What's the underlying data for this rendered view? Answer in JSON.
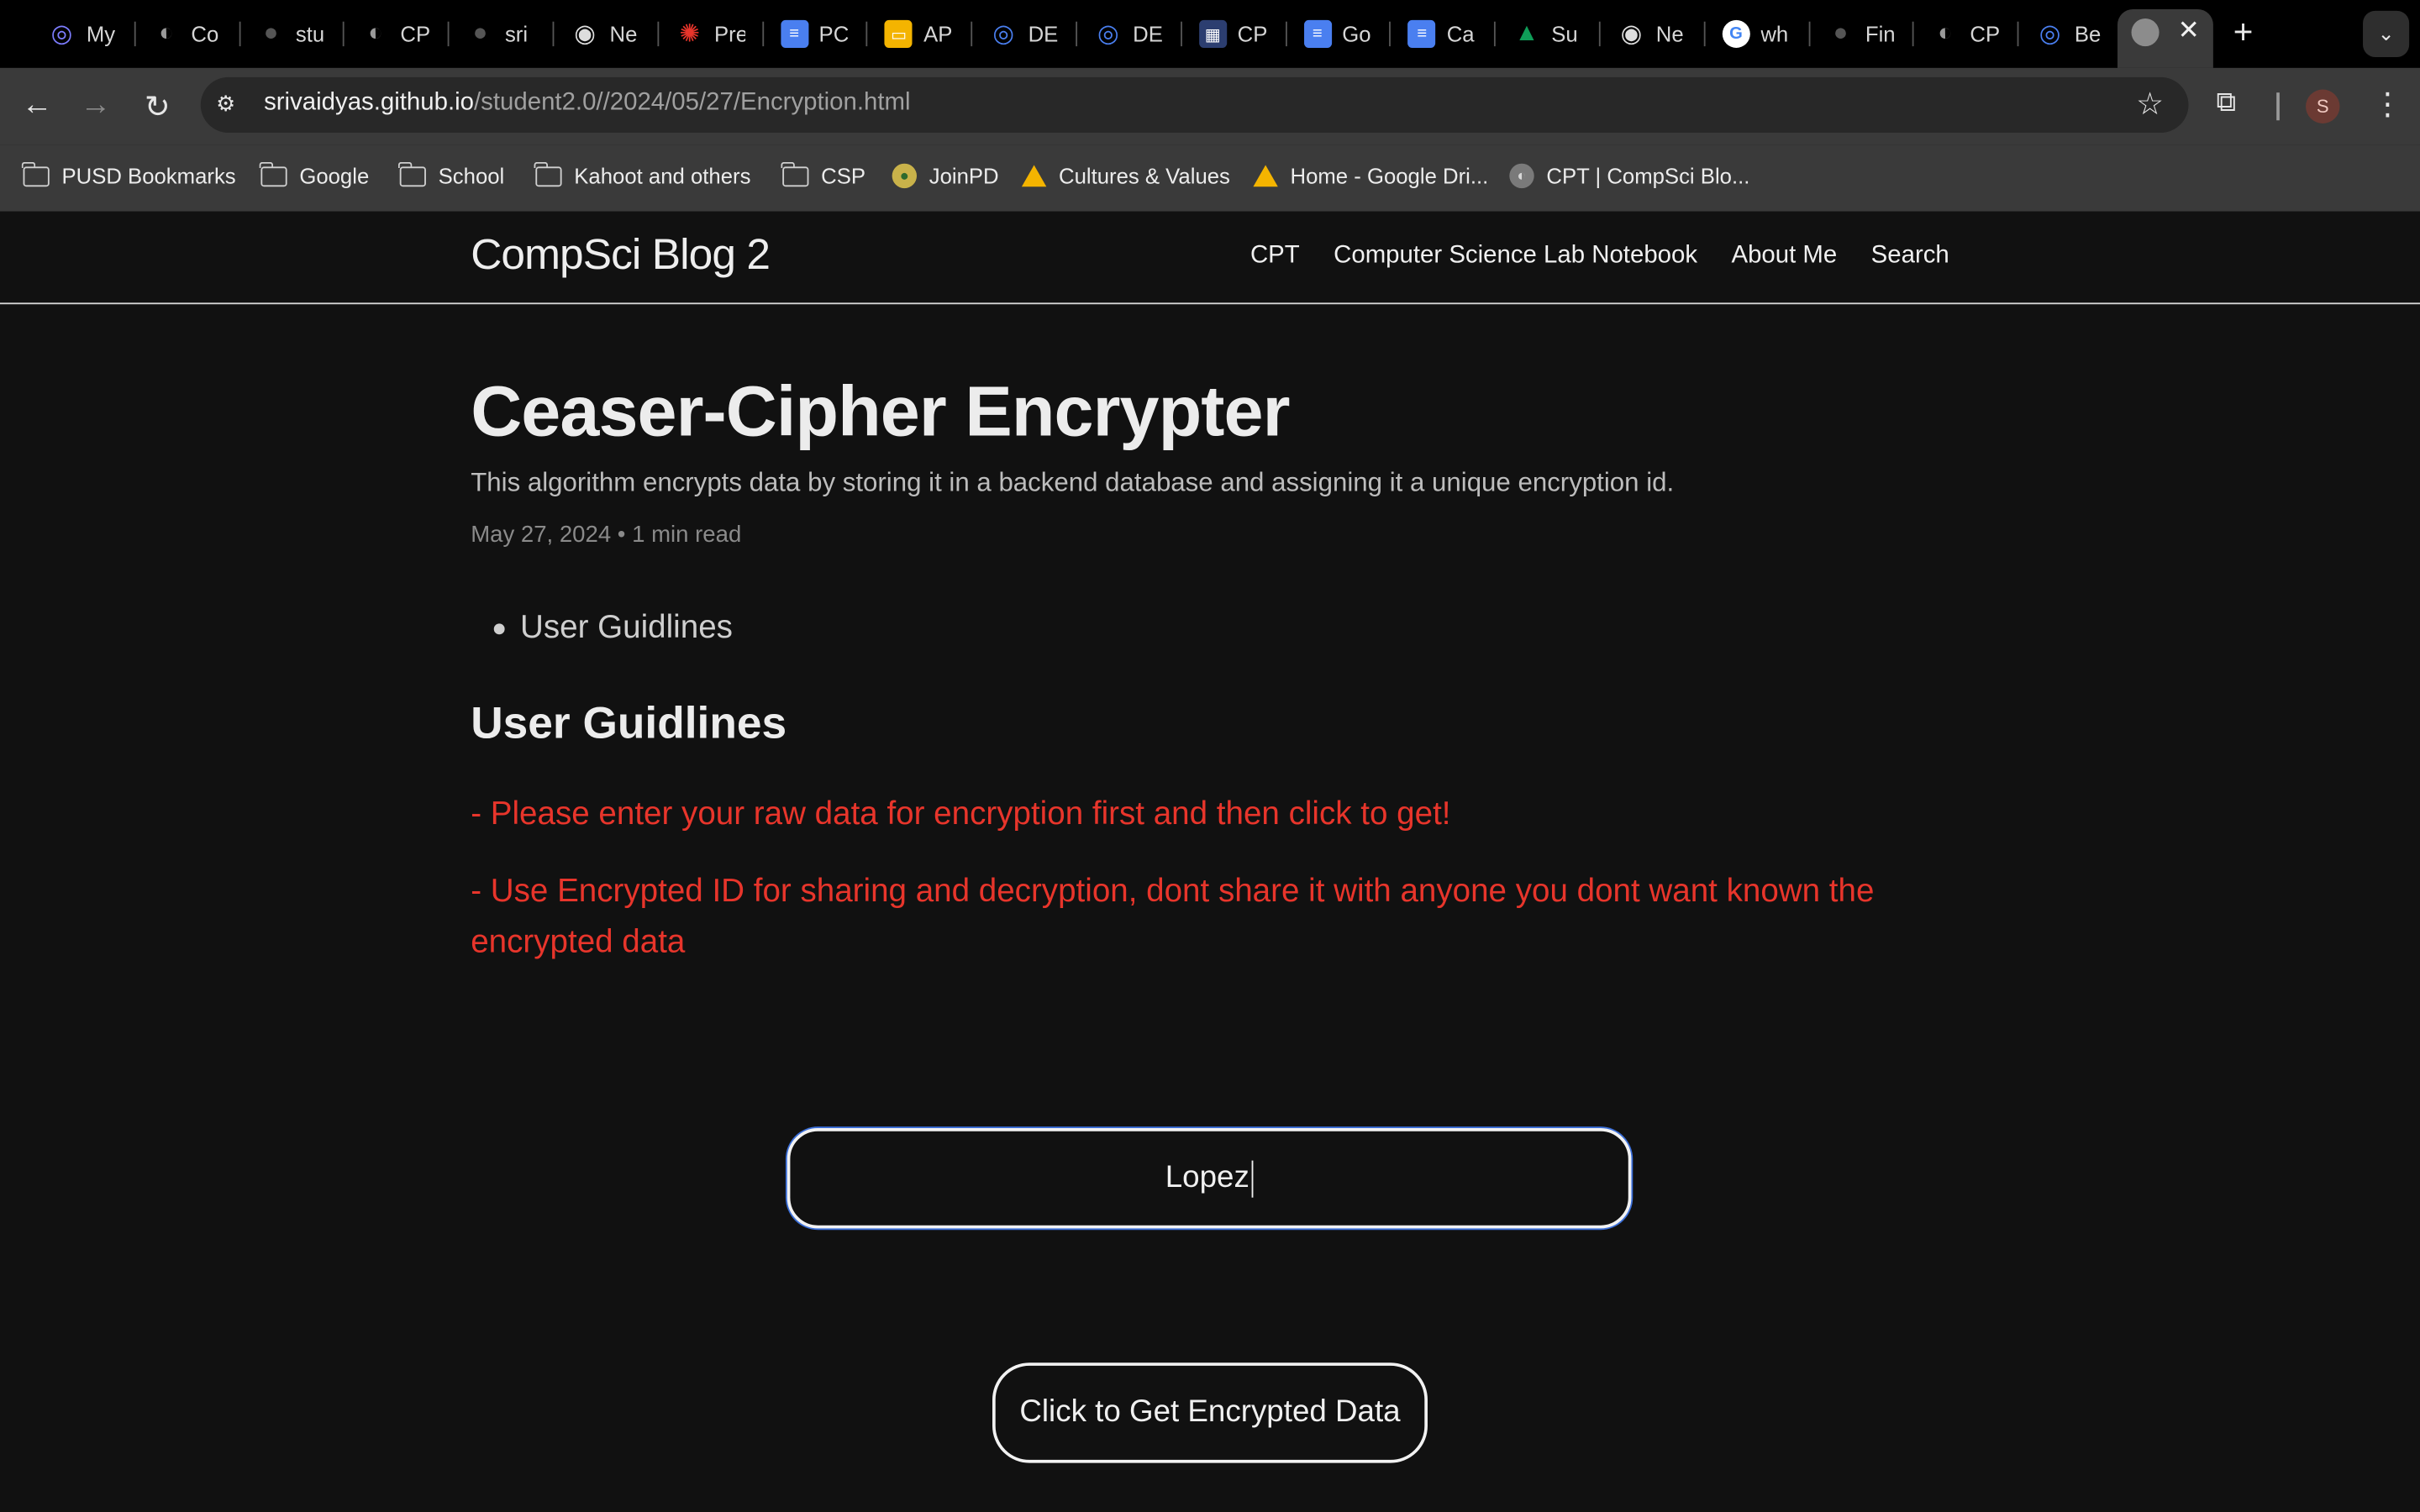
{
  "browser": {
    "tabs": [
      {
        "label": "My",
        "icon": "site-icon",
        "color": "#7d7dff"
      },
      {
        "label": "Co",
        "icon": "globe-icon",
        "color": "#9a9a9a"
      },
      {
        "label": "stu",
        "icon": "github-icon",
        "color": "#555555"
      },
      {
        "label": "CP",
        "icon": "globe-icon",
        "color": "#9a9a9a"
      },
      {
        "label": "sri",
        "icon": "github-icon",
        "color": "#555555"
      },
      {
        "label": "Ne",
        "icon": "chrome-icon",
        "color": "#dddddd"
      },
      {
        "label": "Pre",
        "icon": "gear-icon",
        "color": "#e8352b"
      },
      {
        "label": "PC",
        "icon": "docs-icon",
        "color": "#4a7ff0"
      },
      {
        "label": "AP",
        "icon": "slides-icon",
        "color": "#f4b400"
      },
      {
        "label": "DE",
        "icon": "site-icon",
        "color": "#4a7ff0"
      },
      {
        "label": "DE",
        "icon": "site-icon",
        "color": "#4a7ff0"
      },
      {
        "label": "CP",
        "icon": "cpm-icon",
        "color": "#2c3e70"
      },
      {
        "label": "Go",
        "icon": "docs-icon",
        "color": "#4a7ff0"
      },
      {
        "label": "Ca",
        "icon": "docs-icon",
        "color": "#4a7ff0"
      },
      {
        "label": "Su",
        "icon": "drive-icon",
        "color": "#0f9d58"
      },
      {
        "label": "Ne",
        "icon": "chrome-icon",
        "color": "#dddddd"
      },
      {
        "label": "wh",
        "icon": "google-icon",
        "color": "#ffffff"
      },
      {
        "label": "Fin",
        "icon": "github-icon",
        "color": "#555555"
      },
      {
        "label": "CP",
        "icon": "globe-icon",
        "color": "#9a9a9a"
      },
      {
        "label": "Be",
        "icon": "site-icon",
        "color": "#4a7ff0"
      }
    ],
    "active_tab_close": "✕",
    "url_host": "srivaidyas.github.io",
    "url_path": "/student2.0//2024/05/27/Encryption.html",
    "profile_initial": "S",
    "bookmarks": [
      {
        "label": "PUSD Bookmarks",
        "icon": "managed-folder-icon"
      },
      {
        "label": "Google",
        "icon": "folder-icon"
      },
      {
        "label": "School",
        "icon": "folder-icon"
      },
      {
        "label": "Kahoot and others",
        "icon": "folder-icon"
      },
      {
        "label": "CSP",
        "icon": "folder-icon"
      },
      {
        "label": "JoinPD",
        "icon": "joinpd-icon"
      },
      {
        "label": "Cultures & Values",
        "icon": "drive-icon"
      },
      {
        "label": "Home - Google Dri...",
        "icon": "drive-icon"
      },
      {
        "label": "CPT | CompSci Blo...",
        "icon": "globe-icon"
      }
    ]
  },
  "site": {
    "title": "CompSci Blog 2",
    "nav": [
      "CPT",
      "Computer Science Lab Notebook",
      "About Me",
      "Search"
    ]
  },
  "post": {
    "title": "Ceaser-Cipher Encrypter",
    "description": "This algorithm encrypts data by storing it in a backend database and assigning it a unique encryption id.",
    "meta": "May 27, 2024 • 1 min read",
    "toc_item": "User Guidlines",
    "section_heading": "User Guidlines",
    "guidelines": [
      "- Please enter your raw data for encryption first and then click to get!",
      "- Use Encrypted ID for sharing and decryption, dont share it with anyone you dont want known the encrypted data"
    ]
  },
  "form": {
    "input_value": "Lopez",
    "button_label": "Click to Get Encrypted Data"
  },
  "colors": {
    "accent_red": "#e8352b",
    "focus_ring": "#3b6fd9",
    "background": "#111111"
  }
}
